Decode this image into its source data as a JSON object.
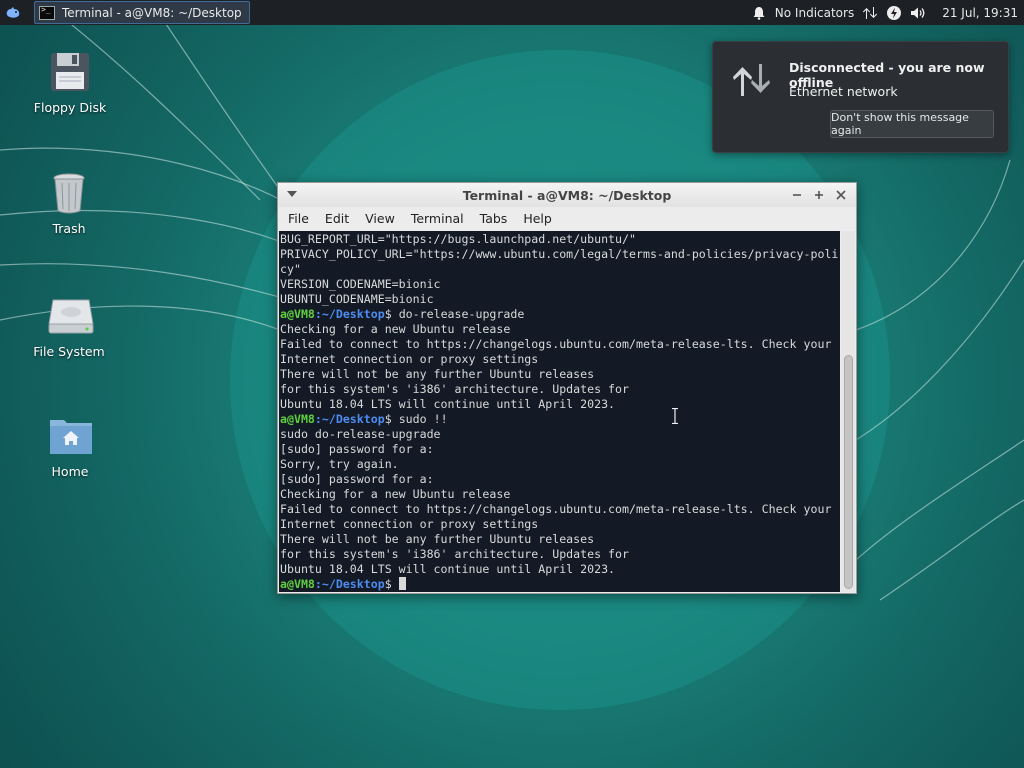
{
  "panel": {
    "task_title": "Terminal - a@VM8: ~/Desktop",
    "indicators_label": "No Indicators",
    "clock": "21 Jul, 19:31"
  },
  "desktop_icons": [
    {
      "label": "Floppy Disk",
      "icon": "floppy-icon"
    },
    {
      "label": "Trash",
      "icon": "trash-icon"
    },
    {
      "label": "File System",
      "icon": "drive-icon"
    },
    {
      "label": "Home",
      "icon": "home-folder-icon"
    }
  ],
  "notification": {
    "title": "Disconnected - you are now offline",
    "body": "Ethernet network",
    "button": "Don't show this message again"
  },
  "terminal": {
    "title": "Terminal - a@VM8: ~/Desktop",
    "menu": [
      "File",
      "Edit",
      "View",
      "Terminal",
      "Tabs",
      "Help"
    ],
    "prompt_user": "a@VM8",
    "prompt_path": ":~/Desktop",
    "lines": [
      {
        "t": "BUG_REPORT_URL=\"https://bugs.launchpad.net/ubuntu/\""
      },
      {
        "t": "PRIVACY_POLICY_URL=\"https://www.ubuntu.com/legal/terms-and-policies/privacy-poli"
      },
      {
        "t": "cy\""
      },
      {
        "t": "VERSION_CODENAME=bionic"
      },
      {
        "t": "UBUNTU_CODENAME=bionic"
      },
      {
        "prompt": true,
        "cmd": "do-release-upgrade"
      },
      {
        "t": "Checking for a new Ubuntu release"
      },
      {
        "t": "Failed to connect to https://changelogs.ubuntu.com/meta-release-lts. Check your"
      },
      {
        "t": "Internet connection or proxy settings"
      },
      {
        "t": "There will not be any further Ubuntu releases"
      },
      {
        "t": "for this system's 'i386' architecture. Updates for"
      },
      {
        "t": "Ubuntu 18.04 LTS will continue until April 2023."
      },
      {
        "prompt": true,
        "cmd": "sudo !!"
      },
      {
        "t": "sudo do-release-upgrade"
      },
      {
        "t": "[sudo] password for a:"
      },
      {
        "t": "Sorry, try again."
      },
      {
        "t": "[sudo] password for a:"
      },
      {
        "t": "Checking for a new Ubuntu release"
      },
      {
        "t": "Failed to connect to https://changelogs.ubuntu.com/meta-release-lts. Check your"
      },
      {
        "t": "Internet connection or proxy settings"
      },
      {
        "t": "There will not be any further Ubuntu releases"
      },
      {
        "t": "for this system's 'i386' architecture. Updates for"
      },
      {
        "t": "Ubuntu 18.04 LTS will continue until April 2023."
      },
      {
        "prompt": true,
        "cmd": "",
        "cursor": true
      }
    ]
  },
  "colors": {
    "terminal_bg": "#131a26",
    "prompt_user": "#5fce3d",
    "prompt_path": "#4d8cf0",
    "panel_bg": "#1d2024"
  }
}
